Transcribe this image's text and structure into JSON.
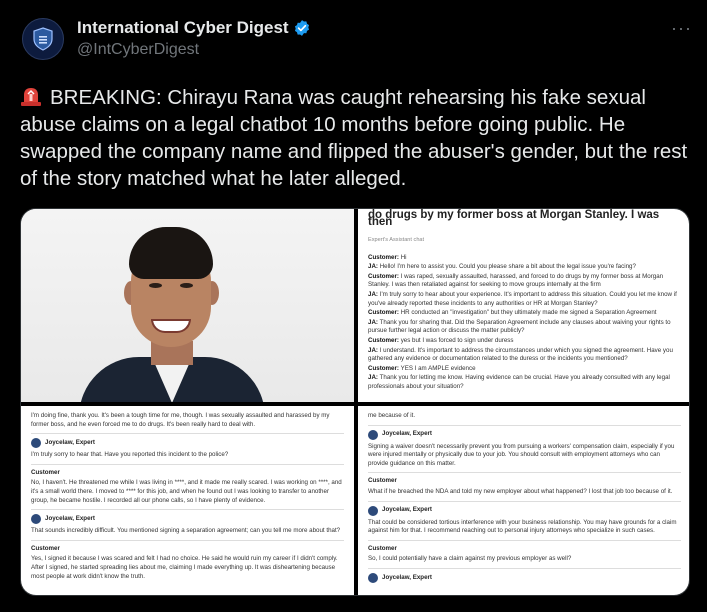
{
  "account": {
    "name": "International Cyber Digest",
    "handle": "@IntCyberDigest",
    "verified": true,
    "avatar_icon": "shield-logo-icon",
    "more_label": "···"
  },
  "tweet": {
    "emoji": "rotating-light-icon",
    "text": "BREAKING: Chirayu Rana was caught rehearsing his fake sexual abuse claims on a legal chatbot 10 months before going public. He swapped the company name and flipped the abuser's gender, but the rest of the story matched what he later alleged."
  },
  "media": {
    "chat1": {
      "title_l1": "do drugs by my former boss at Morgan Stanley. I was",
      "title_l2": "then",
      "sub": "Expert's Assistant chat",
      "lines": [
        {
          "who": "Customer:",
          "text": "Hi"
        },
        {
          "who": "JA:",
          "text": "Hello! I'm here to assist you. Could you please share a bit about the legal issue you're facing?"
        },
        {
          "who": "Customer:",
          "text": "I was raped, sexually assaulted, harassed, and forced to do drugs by my former boss at Morgan Stanley. I was then retaliated against for seeking to move groups internally at the firm"
        },
        {
          "who": "JA:",
          "text": "I'm truly sorry to hear about your experience. It's important to address this situation. Could you let me know if you've already reported these incidents to any authorities or HR at Morgan Stanley?"
        },
        {
          "who": "Customer:",
          "text": "HR conducted an \"investigation\" but they ultimately made me signed a Separation Agreement"
        },
        {
          "who": "JA:",
          "text": "Thank you for sharing that. Did the Separation Agreement include any clauses about waiving your rights to pursue further legal action or discuss the matter publicly?"
        },
        {
          "who": "Customer:",
          "text": "yes but I was forced to sign under duress"
        },
        {
          "who": "JA:",
          "text": "I understand. It's important to address the circumstances under which you signed the agreement. Have you gathered any evidence or documentation related to the duress or the incidents you mentioned?"
        },
        {
          "who": "Customer:",
          "text": "YES I am AMPLE evidence"
        },
        {
          "who": "JA:",
          "text": "Thank you for letting me know. Having evidence can be crucial. Have you already consulted with any legal professionals about your situation?"
        }
      ]
    },
    "chat2": {
      "intro": "I'm doing fine, thank you. It's been a tough time for me, though. I was sexually assaulted and harassed by my former boss, and he even forced me to do drugs. It's been really hard to deal with.",
      "expert": "Joycelaw, Expert",
      "customer": "Customer",
      "e1": "I'm truly sorry to hear that. Have you reported this incident to the police?",
      "c1": "No, I haven't. He threatened me while I was living in ****, and it made me really scared. I was working on ****, and it's a small world there. I moved to **** for this job, and when he found out I was looking to transfer to another group, he became hostile. I recorded all our phone calls, so I have plenty of evidence.",
      "e2": "That sounds incredibly difficult. You mentioned signing a separation agreement; can you tell me more about that?",
      "c2": "Yes, I signed it because I was scared and felt I had no choice. He said he would ruin my career if I didn't comply. After I signed, he started spreading lies about me, claiming I made everything up. It was disheartening because most people at work didn't know the truth."
    },
    "chat3": {
      "intro": "me because of it.",
      "expert": "Joycelaw, Expert",
      "customer": "Customer",
      "e1": "Signing a waiver doesn't necessarily prevent you from pursuing a workers' compensation claim, especially if you were injured mentally or physically due to your job. You should consult with employment attorneys who can provide guidance on this matter.",
      "c1": "What if he breached the NDA and told my new employer about what happened? I lost that job too because of it.",
      "e2": "That could be considered tortious interference with your business relationship. You may have grounds for a claim against him for that. I recommend reaching out to personal injury attorneys who specialize in such cases.",
      "c2": "So, I could potentially have a claim against my previous employer as well?",
      "expert_tail": "Joycelaw, Expert"
    }
  }
}
